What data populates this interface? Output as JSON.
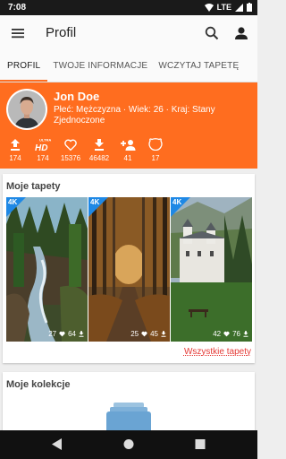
{
  "status": {
    "time": "7:08",
    "network": "LTE"
  },
  "appbar": {
    "title": "Profil"
  },
  "tabs": [
    "PROFIL",
    "TWOJE INFORMACJE",
    "WCZYTAJ TAPETĘ"
  ],
  "profile": {
    "name": "Jon Doe",
    "info": "Płeć: Mężczyzna · Wiek: 26 · Kraj: Stany Zjednoczone",
    "stats": [
      "174",
      "174",
      "15376",
      "46482",
      "41",
      "17"
    ]
  },
  "wallpapers": {
    "title": "Moje tapety",
    "badge": "4K",
    "items": [
      {
        "likes": "27",
        "downloads": "64"
      },
      {
        "likes": "25",
        "downloads": "45"
      },
      {
        "likes": "42",
        "downloads": "76"
      }
    ],
    "all_link": "Wszystkie tapety"
  },
  "collections": {
    "title": "Moje kolekcje"
  },
  "colors": {
    "accent": "#ff6d1f",
    "badge": "#1e88e5",
    "link": "#e53935"
  }
}
